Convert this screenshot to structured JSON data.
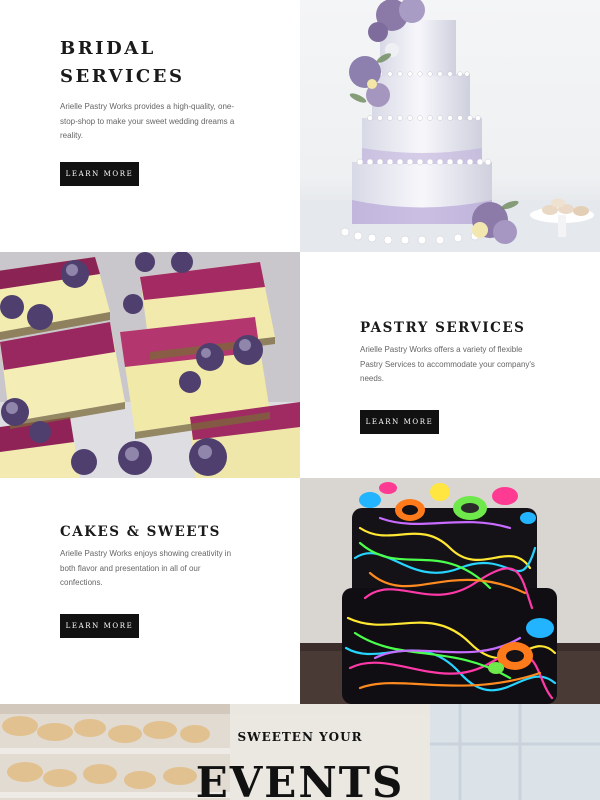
{
  "bridal": {
    "title_line1": "BRIDAL",
    "title_line2": "SERVICES",
    "description": "Arielle Pastry Works provides a high-quality, one-stop-shop to make your sweet wedding dreams a reality.",
    "button_label": "LEARN MORE",
    "image": "wedding-cake-photo"
  },
  "pastry": {
    "title": "PASTRY SERVICES",
    "description": "Arielle Pastry Works offers a variety of flexible Pastry Services to accommodate your company's needs.",
    "button_label": "LEARN MORE",
    "image": "berry-cheesecake-bars-photo"
  },
  "cakes": {
    "title": "CAKES & SWEETS",
    "description": "Arielle Pastry Works enjoys showing creativity in both flavor and presentation in all of our confections.",
    "button_label": "LEARN MORE",
    "image": "neon-splatter-cake-photo"
  },
  "events": {
    "subtitle": "SWEETEN YOUR",
    "title": "EVENTS",
    "image": "bakery-shelves-background"
  },
  "colors": {
    "button_bg": "#111111",
    "button_text": "#ffffff",
    "heading": "#1a1a1a",
    "body_text": "#666666"
  }
}
